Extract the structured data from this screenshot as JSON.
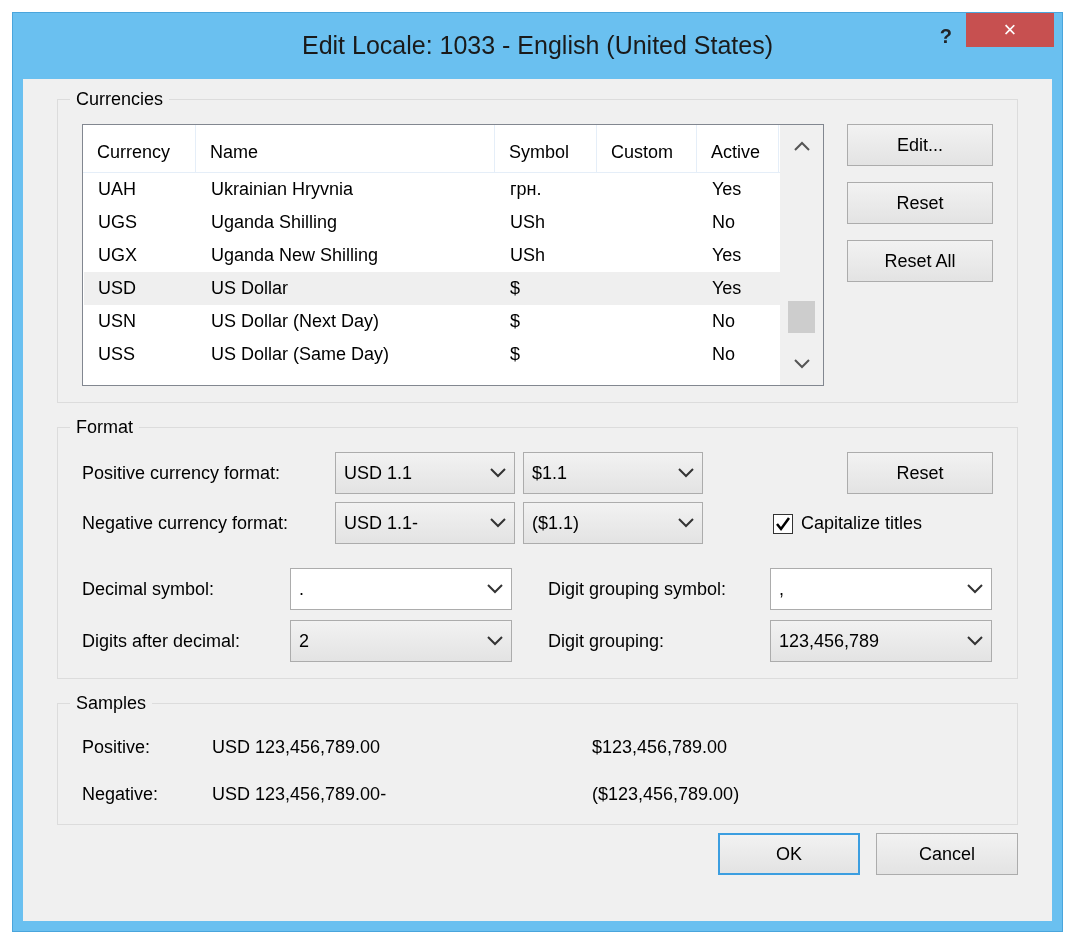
{
  "window": {
    "title": "Edit Locale: 1033 - English (United States)",
    "help": "?",
    "close": "×"
  },
  "currencies": {
    "legend": "Currencies",
    "columns": [
      "Currency",
      "Name",
      "Symbol",
      "Custom",
      "Active"
    ],
    "rows": [
      {
        "cells": [
          "UAH",
          "Ukrainian Hryvnia",
          "грн.",
          "",
          "Yes"
        ],
        "selected": false
      },
      {
        "cells": [
          "UGS",
          "Uganda Shilling",
          "USh",
          "",
          "No"
        ],
        "selected": false
      },
      {
        "cells": [
          "UGX",
          "Uganda New Shilling",
          "USh",
          "",
          "Yes"
        ],
        "selected": false
      },
      {
        "cells": [
          "USD",
          "US Dollar",
          "$",
          "",
          "Yes"
        ],
        "selected": true
      },
      {
        "cells": [
          "USN",
          "US Dollar (Next Day)",
          "$",
          "",
          "No"
        ],
        "selected": false
      },
      {
        "cells": [
          "USS",
          "US Dollar (Same Day)",
          "$",
          "",
          "No"
        ],
        "selected": false
      }
    ],
    "buttons": [
      "Edit...",
      "Reset",
      "Reset All"
    ]
  },
  "format": {
    "legend": "Format",
    "positive_label": "Positive currency format:",
    "positive": [
      {
        "value": "USD 1.1",
        "kind": "list"
      },
      {
        "value": "$1.1",
        "kind": "list"
      }
    ],
    "negative_label": "Negative currency format:",
    "negative": [
      {
        "value": "USD 1.1-",
        "kind": "list"
      },
      {
        "value": "($1.1)",
        "kind": "list"
      }
    ],
    "reset": "Reset",
    "capitalize": {
      "label": "Capitalize titles",
      "checked": true
    },
    "fields": [
      {
        "label": "Decimal symbol:",
        "value": ".",
        "kind": "editable"
      },
      {
        "label": "Digit grouping symbol:",
        "value": ",",
        "kind": "editable"
      },
      {
        "label": "Digits after decimal:",
        "value": "2",
        "kind": "list"
      },
      {
        "label": "Digit grouping:",
        "value": "123,456,789",
        "kind": "list"
      }
    ]
  },
  "samples": {
    "legend": "Samples",
    "rows": [
      {
        "label": "Positive:",
        "values": [
          "USD 123,456,789.00",
          "$123,456,789.00"
        ]
      },
      {
        "label": "Negative:",
        "values": [
          "USD 123,456,789.00-",
          "($123,456,789.00)"
        ]
      }
    ]
  },
  "buttons": [
    "OK",
    "Cancel"
  ]
}
